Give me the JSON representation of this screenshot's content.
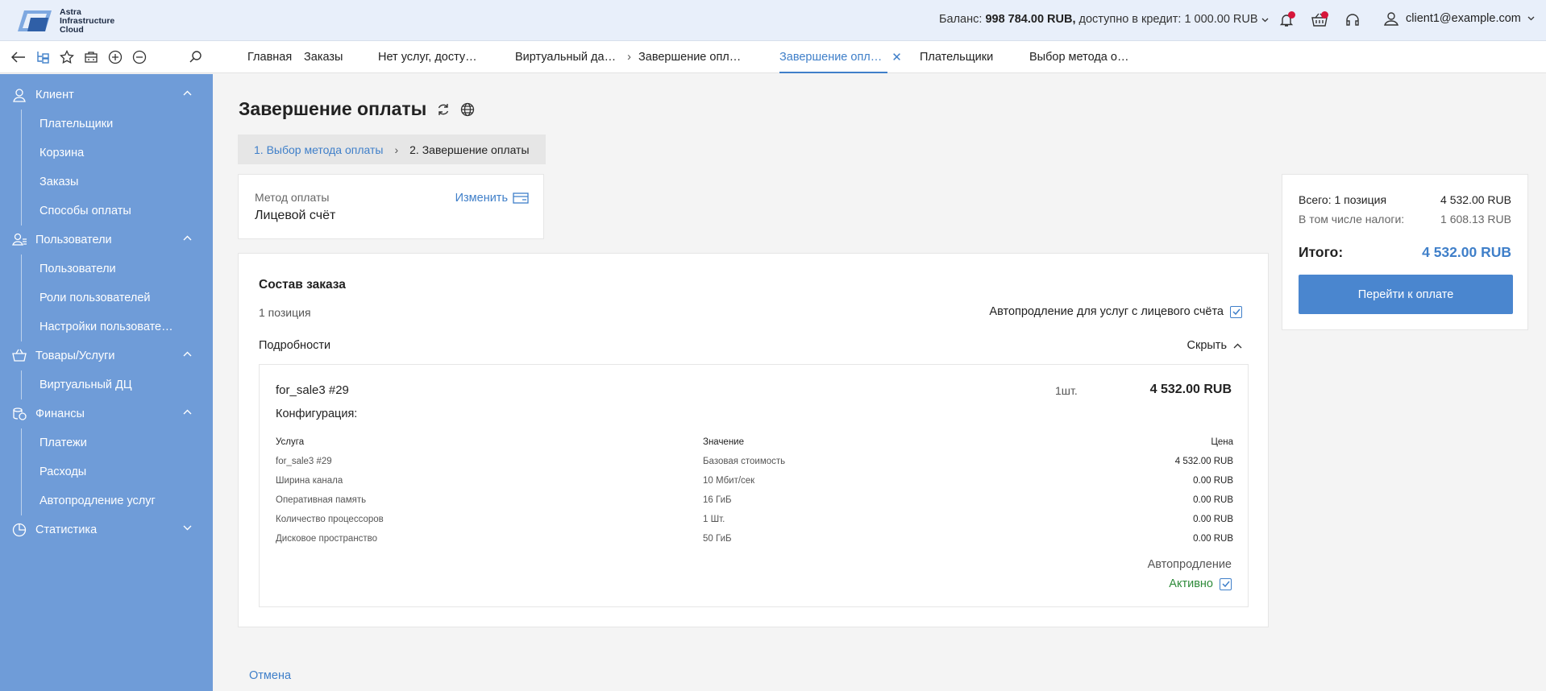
{
  "header": {
    "logo_lines": [
      "Astra",
      "Infrastructure",
      "Cloud"
    ],
    "balance_label": "Баланс:",
    "balance_value": "998 784.00 RUB,",
    "credit_label": "доступно в кредит:",
    "credit_value": "1 000.00 RUB",
    "user_email": "client1@example.com",
    "icons": [
      "bell-icon",
      "basket-icon",
      "headset-icon",
      "user-icon"
    ],
    "notification_color": "#d6163a"
  },
  "toolbar": {
    "icons": [
      "back-icon",
      "tree-icon",
      "star-icon",
      "briefcase-icon",
      "plus-circle-icon",
      "minus-circle-icon",
      "search-icon"
    ]
  },
  "tabs": [
    {
      "label": "Главная",
      "active": false
    },
    {
      "label": "Заказы",
      "active": false
    },
    {
      "label": "Нет услуг, досту…",
      "active": false
    },
    {
      "label": "Виртуальный да…",
      "active": false
    },
    {
      "label": "Завершение опл…",
      "active": false
    },
    {
      "label": "Завершение опл…",
      "active": true
    },
    {
      "label": "Плательщики",
      "active": false
    },
    {
      "label": "Выбор метода о…",
      "active": false
    }
  ],
  "sidebar": {
    "groups": [
      {
        "label": "Клиент",
        "items": [
          "Плательщики",
          "Корзина",
          "Заказы",
          "Способы оплаты"
        ]
      },
      {
        "label": "Пользователи",
        "items": [
          "Пользователи",
          "Роли пользователей",
          "Настройки пользовате…"
        ]
      },
      {
        "label": "Товары/Услуги",
        "items": [
          "Виртуальный ДЦ"
        ]
      },
      {
        "label": "Финансы",
        "items": [
          "Платежи",
          "Расходы",
          "Автопродление услуг"
        ]
      },
      {
        "label": "Статистика",
        "items": []
      }
    ],
    "bg_color": "#6f9cd8"
  },
  "page": {
    "title": "Завершение оплаты",
    "steps": [
      "1. Выбор метода оплаты",
      "2. Завершение оплаты"
    ]
  },
  "method": {
    "label": "Метод оплаты",
    "value": "Лицевой счёт",
    "change_label": "Изменить"
  },
  "order": {
    "title": "Состав заказа",
    "count": "1 позиция",
    "autorenew_label": "Автопродление для услуг с лицевого счёта",
    "details_label": "Подробности",
    "hide_label": "Скрыть",
    "item": {
      "name": "for_sale3 #29",
      "qty": "1шт.",
      "price": "4 532.00 RUB",
      "config_label": "Конфигурация:",
      "headers": [
        "Услуга",
        "Значение",
        "Цена"
      ],
      "rows": [
        [
          "for_sale3 #29",
          "Базовая стоимость",
          "4 532.00 RUB"
        ],
        [
          "Ширина канала",
          "10 Мбит/сек",
          "0.00 RUB"
        ],
        [
          "Оперативная память",
          "16 ГиБ",
          "0.00 RUB"
        ],
        [
          "Количество процессоров",
          "1 Шт.",
          "0.00 RUB"
        ],
        [
          "Дисковое пространство",
          "50 ГиБ",
          "0.00 RUB"
        ]
      ],
      "autorenew_label": "Автопродление",
      "autorenew_status": "Активно"
    }
  },
  "summary": {
    "total_label": "Всего: 1 позиция",
    "total_value": "4 532.00 RUB",
    "tax_label": "В том числе налоги:",
    "tax_value": "1 608.13 RUB",
    "grand_label": "Итого:",
    "grand_value": "4 532.00 RUB",
    "pay_button": "Перейти к оплате"
  },
  "footer": {
    "cancel_label": "Отмена"
  },
  "colors": {
    "accent": "#3f7fc9",
    "active_green": "#2e8b3a"
  }
}
